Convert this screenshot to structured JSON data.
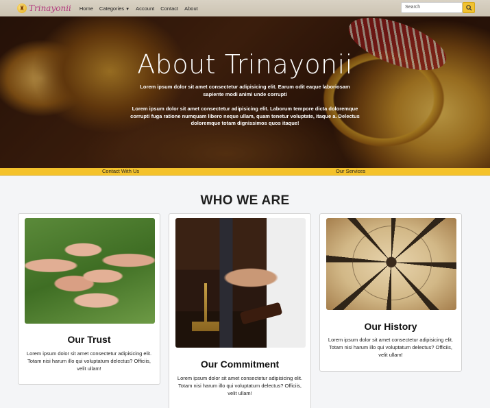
{
  "brand": {
    "name": "Trinayonii",
    "logo_icon": "temple-lamp-icon"
  },
  "nav": {
    "links": [
      {
        "label": "Home"
      },
      {
        "label": "Categories"
      },
      {
        "label": "Account"
      },
      {
        "label": "Contact"
      },
      {
        "label": "About"
      }
    ],
    "search_placeholder": "Search",
    "search_icon": "search-icon"
  },
  "hero": {
    "title": "About Trinayonii",
    "paragraph1": "Lorem ipsum dolor sit amet consectetur adipisicing elit. Earum odit eaque laboriosam sapiente modi animi unde corrupti",
    "paragraph2": "Lorem ipsum dolor sit amet consectetur adipisicing elit. Laborum tempore dicta doloremque corrupti fuga ratione numquam libero neque ullam, quam tenetur voluptate, itaque a. Delectus doloremque totam dignissimos quos itaque!"
  },
  "strip": {
    "contact": "Contact With Us",
    "services": "Our Services"
  },
  "section": {
    "title": "WHO WE ARE"
  },
  "cards": [
    {
      "title": "Our Trust",
      "text": "Lorem ipsum dolor sit amet consectetur adipisicing elit. Totam nisi harum illo qui voluptatum delectus? Officiis, velit ullam!"
    },
    {
      "title": "Our Commitment",
      "text": "Lorem ipsum dolor sit amet consectetur adipisicing elit. Totam nisi harum illo qui voluptatum delectus? Officiis, velit ullam!"
    },
    {
      "title": "Our History",
      "text": "Lorem ipsum dolor sit amet consectetur adipisicing elit. Totam nisi harum illo qui voluptatum delectus? Officiis, velit ullam!"
    }
  ],
  "colors": {
    "accent": "#f4c22b",
    "brand": "#b2397d"
  }
}
